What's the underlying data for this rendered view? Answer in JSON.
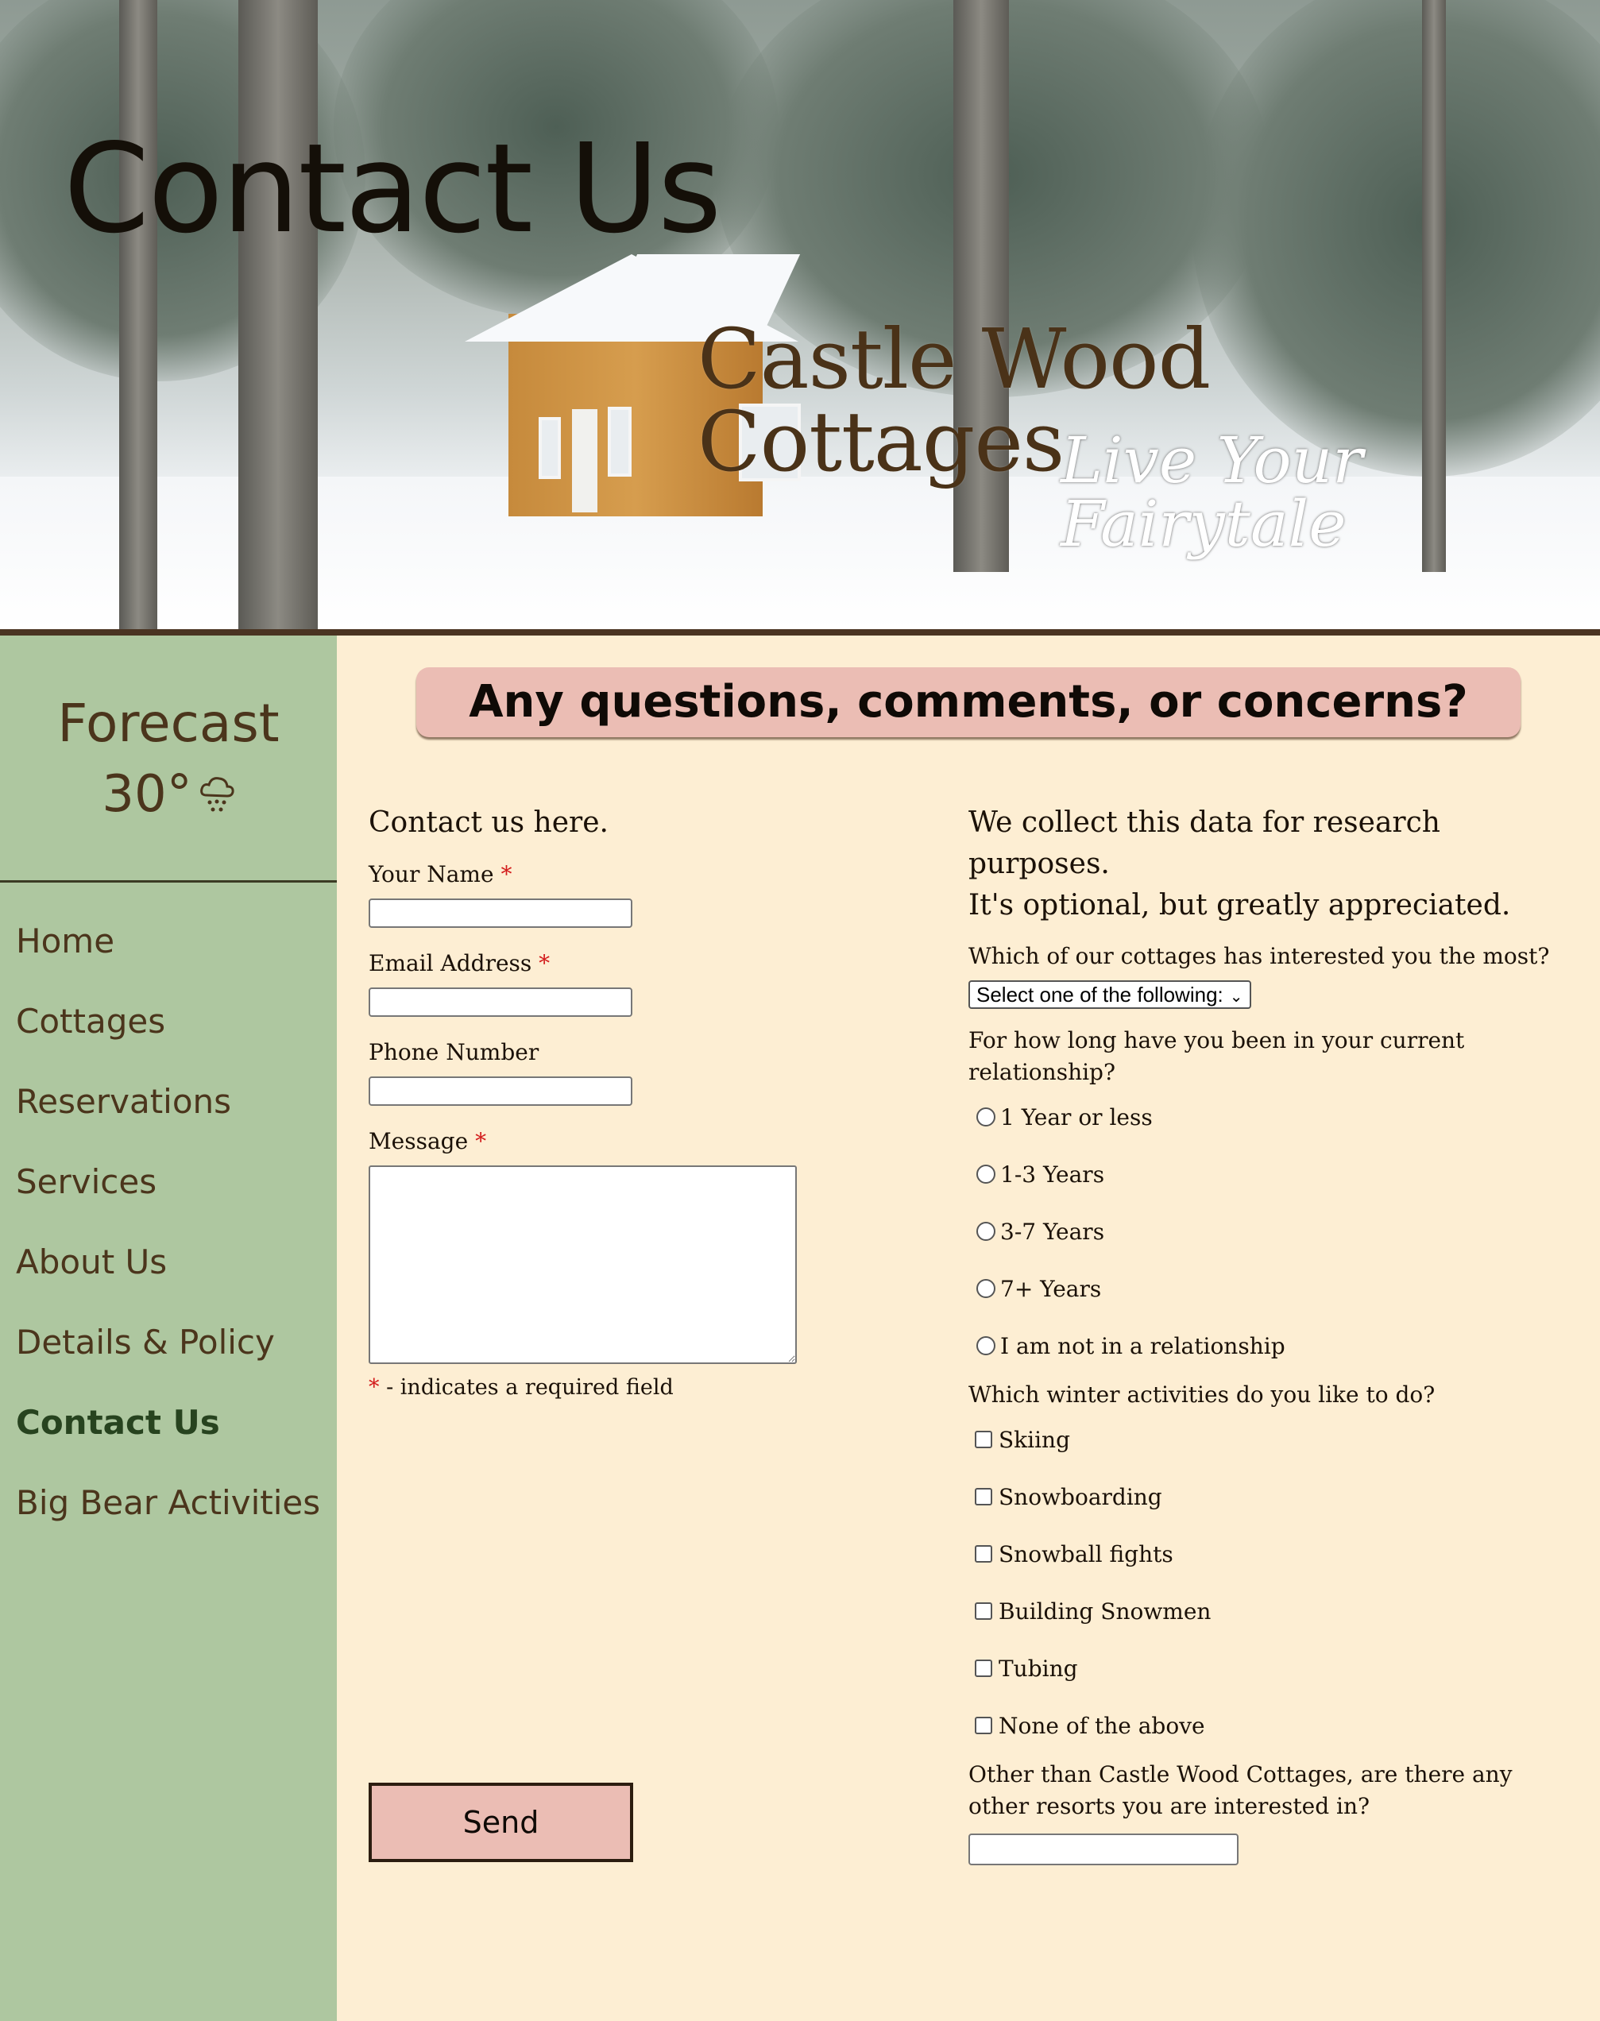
{
  "banner": {
    "title": "Contact Us",
    "brand_name": "Castle Wood Cottages",
    "tagline": "Live Your Fairytale"
  },
  "sidebar": {
    "forecast_title": "Forecast",
    "forecast_temp": "30°",
    "forecast_icon": "snow-cloud-icon",
    "nav": [
      {
        "label": "Home"
      },
      {
        "label": "Cottages"
      },
      {
        "label": "Reservations"
      },
      {
        "label": "Services"
      },
      {
        "label": "About Us"
      },
      {
        "label": "Details & Policy"
      },
      {
        "label": "Contact Us",
        "active": true
      },
      {
        "label": "Big Bear Activities"
      }
    ]
  },
  "main": {
    "heading": "Any questions, comments, or concerns?",
    "contact_form": {
      "intro": "Contact us here.",
      "name_label": "Your Name",
      "email_label": "Email Address",
      "phone_label": "Phone Number",
      "message_label": "Message",
      "required_marker": "*",
      "required_note": "- indicates a required field",
      "send_label": "Send"
    },
    "survey": {
      "intro_line1": "We collect this data for research purposes.",
      "intro_line2": "It's optional, but greatly appreciated.",
      "cottage_question": "Which of our cottages has interested you the most?",
      "cottage_select_value": "Select one of the following:",
      "relationship_question": "For how long have you been in your current relationship?",
      "relationship_options": [
        "1 Year or less",
        "1-3 Years",
        "3-7 Years",
        "7+ Years",
        "I am not in a relationship"
      ],
      "activities_question": "Which winter activities do you like to do?",
      "activity_options": [
        "Skiing",
        "Snowboarding",
        "Snowball fights",
        "Building Snowmen",
        "Tubing",
        "None of the above"
      ],
      "resorts_question": "Other than Castle Wood Cottages, are there any other resorts you are interested in?"
    }
  },
  "colors": {
    "page_bg": "#fdeed3",
    "sidebar_bg": "#aec7a0",
    "accent_pink": "#ebbdb4",
    "brown_text": "#4b351c",
    "active_nav": "#27431f",
    "required_red": "#d31c1c"
  }
}
